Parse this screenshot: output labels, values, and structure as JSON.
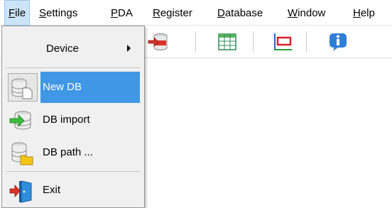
{
  "menubar": {
    "items": [
      {
        "label": "File",
        "active": true
      },
      {
        "label": "Settings"
      },
      {
        "label": "PDA"
      },
      {
        "label": "Register"
      },
      {
        "label": "Database"
      },
      {
        "label": "Window"
      },
      {
        "label": "Help"
      }
    ]
  },
  "toolbar": {
    "buttons": [
      "db-export-icon",
      "table-icon",
      "frame-icon",
      "info-icon"
    ]
  },
  "file_menu": {
    "items": [
      {
        "label": "Device",
        "has_submenu": true
      },
      {
        "label": "New DB",
        "icon": "new-db-icon",
        "highlighted": true
      },
      {
        "label": "DB import",
        "icon": "db-import-icon"
      },
      {
        "label": "DB path ...",
        "icon": "db-path-icon"
      },
      {
        "label": "Exit",
        "icon": "exit-icon"
      }
    ]
  },
  "colors": {
    "highlight": "#3f97e6",
    "menu_bg": "#f0f0f0",
    "menubar_active": "#cce4f7"
  }
}
